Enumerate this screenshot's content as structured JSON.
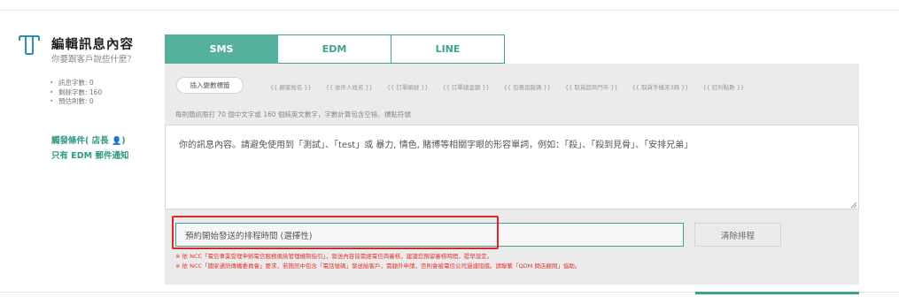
{
  "section": {
    "icon": "text-t-icon",
    "title": "編輯訊息內容",
    "subtitle": "你要跟客戶說些什麼？"
  },
  "stats": [
    "訊息字數: 0",
    "剩餘字數: 160",
    "預估則數: 0"
  ],
  "trigger": {
    "label": "觸發條件( 店長 ",
    "close": ")",
    "icon": "person-icon",
    "edm_only": "只有 EDM 郵件通知"
  },
  "tabs": [
    "SMS",
    "EDM",
    "LINE"
  ],
  "active_tab": "SMS",
  "variables": {
    "button_label": "插入變數標籤",
    "tags": [
      "{{ 顧客姓名 }}",
      "{{ 收件人姓名 }}",
      "{{ 訂單編號 }}",
      "{{ 訂單總金額 }}",
      "{{ 包裹追蹤碼 }}",
      "{{ 取貨超商門市 }}",
      "{{ 取貨手機末3碼 }}",
      "{{ 紅利點數 }}"
    ]
  },
  "hint": "每則簡訊限打 70 個中文字或 160 個純英文數字，字數計算包含空格、標點符號",
  "message": {
    "placeholder": "你的訊息內容。請避免使用到「測試」、「test」或 暴力, 情色, 賭博等相關字眼的形容單詞，例如：「殺」、「殺到見骨」、「安排兄弟」"
  },
  "schedule": {
    "placeholder": "預約開始發送的排程時間 (選擇性)",
    "clear_label": "清除排程"
  },
  "notes": [
    "※ 依 NCC「電信事業受理申辦電信服務風險管理機制指引」，發送內容皆需經電信商審核，建議您預留審核時間，提早設定。",
    "※ 依 NCC「國家通訊傳播委員會」要求，若簡訊中包含「電話號碼」發送給客戶，需額外申請，否則會被電信公司過濾阻擋。請聯繫「QDM 問店顧問」協助。"
  ],
  "colors": {
    "accent": "#3aa58f",
    "highlight": "#e0242b"
  }
}
